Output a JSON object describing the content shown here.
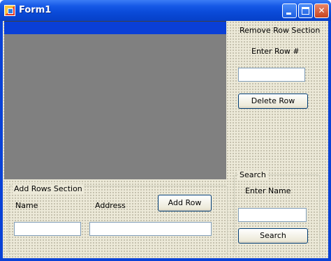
{
  "window": {
    "title": "Form1",
    "minimize_glyph": "",
    "maximize_glyph": "",
    "close_glyph": "✕"
  },
  "remove_section": {
    "title": "Remove Row Section",
    "enter_row_label": "Enter Row #",
    "row_input_value": "",
    "delete_button_label": "Delete Row"
  },
  "search_section": {
    "legend": "Search",
    "enter_name_label": "Enter Name",
    "name_input_value": "",
    "search_button_label": "Search"
  },
  "add_section": {
    "legend": "Add Rows Section",
    "name_label": "Name",
    "address_label": "Address",
    "add_button_label": "Add Row",
    "name_input_value": "",
    "address_input_value": ""
  },
  "colors": {
    "title_bar": "#0a4ad8",
    "form_background": "#ece9d8",
    "grid_background": "#808080",
    "grid_header": "#0a3fd6"
  }
}
